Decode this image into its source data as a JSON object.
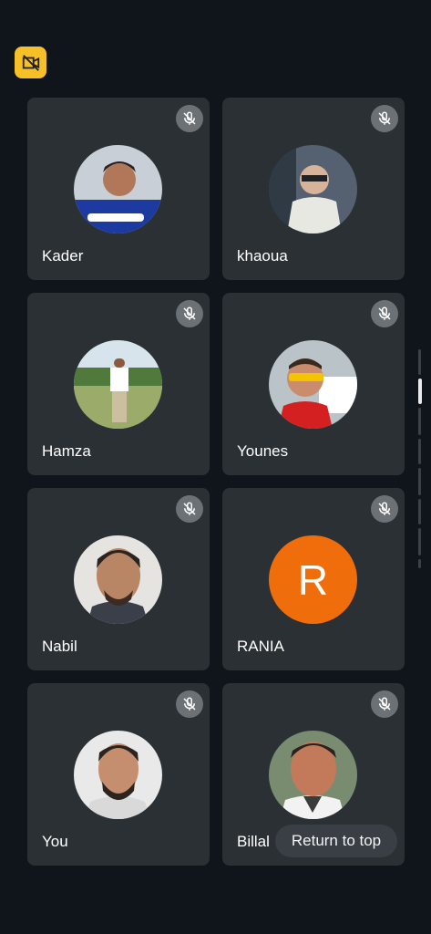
{
  "participants": [
    {
      "name": "Kader",
      "avatar": "photo"
    },
    {
      "name": "khaoua",
      "avatar": "photo"
    },
    {
      "name": "Hamza",
      "avatar": "photo"
    },
    {
      "name": "Younes",
      "avatar": "photo"
    },
    {
      "name": "Nabil",
      "avatar": "photo"
    },
    {
      "name": "RANIA",
      "avatar": "letter",
      "initial": "R"
    },
    {
      "name": "You",
      "avatar": "photo"
    },
    {
      "name": "Billal",
      "avatar": "photo"
    }
  ],
  "return_to_top": "Return to top",
  "icons": {
    "badge": "camera-off-icon",
    "mute": "mic-off-icon"
  },
  "colors": {
    "badge": "#f6c026",
    "rania_avatar": "#f06d0c",
    "background": "#10141b",
    "tile": "#2b3035"
  }
}
